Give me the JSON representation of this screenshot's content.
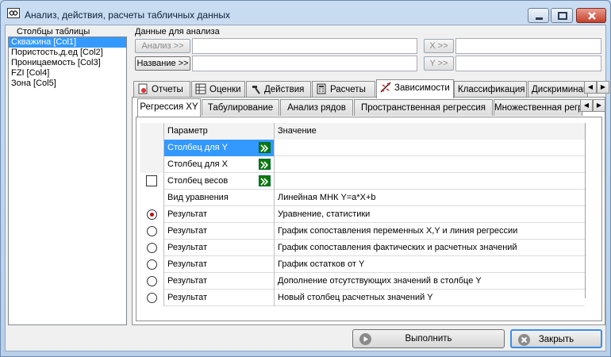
{
  "window": {
    "title": "Анализ, действия, расчеты табличных данных"
  },
  "columns_panel": {
    "header": "Столбцы таблицы",
    "items": [
      "Скважина [Col1]",
      "Пористость,д.ед [Col2]",
      "Проницаемость [Col3]",
      "FZI [Col4]",
      "Зона [Col5]"
    ],
    "selected_index": 0
  },
  "analysis": {
    "header": "Данные для анализа",
    "analysis_btn": "Анализ >>",
    "name_btn": "Название >>",
    "x_btn": "X >>",
    "y_btn": "Y >>"
  },
  "tabs": [
    "Отчеты",
    "Оценки",
    "Действия",
    "Расчеты",
    "Зависимости",
    "Классификация",
    "Дискриминан"
  ],
  "active_tab": 4,
  "subtabs": [
    "Регрессия XY",
    "Табулирование",
    "Анализ рядов",
    "Пространственная регрессия",
    "Множественная регр"
  ],
  "active_subtab": 0,
  "grid": {
    "col_param": "Параметр",
    "col_value": "Значение",
    "rows": [
      {
        "param": "Столбец для Y",
        "value": ""
      },
      {
        "param": "Столбец для X",
        "value": ""
      },
      {
        "param": "Столбец весов",
        "value": ""
      },
      {
        "param": "Вид уравнения",
        "value": "Линейная МНК Y=a*X+b"
      },
      {
        "param": "Результат",
        "value": "Уравнение, статистики"
      },
      {
        "param": "Результат",
        "value": "График сопоставления переменных X,Y и линия регрессии"
      },
      {
        "param": "Результат",
        "value": "График сопоставления фактических и расчетных значений"
      },
      {
        "param": "Результат",
        "value": "График остатков от Y"
      },
      {
        "param": "Результат",
        "value": "Дополнение отсутствующих значений в столбце Y"
      },
      {
        "param": "Результат",
        "value": "Новый столбец расчетных значений Y"
      }
    ]
  },
  "footer": {
    "run": "Выполнить",
    "close": "Закрыть"
  }
}
